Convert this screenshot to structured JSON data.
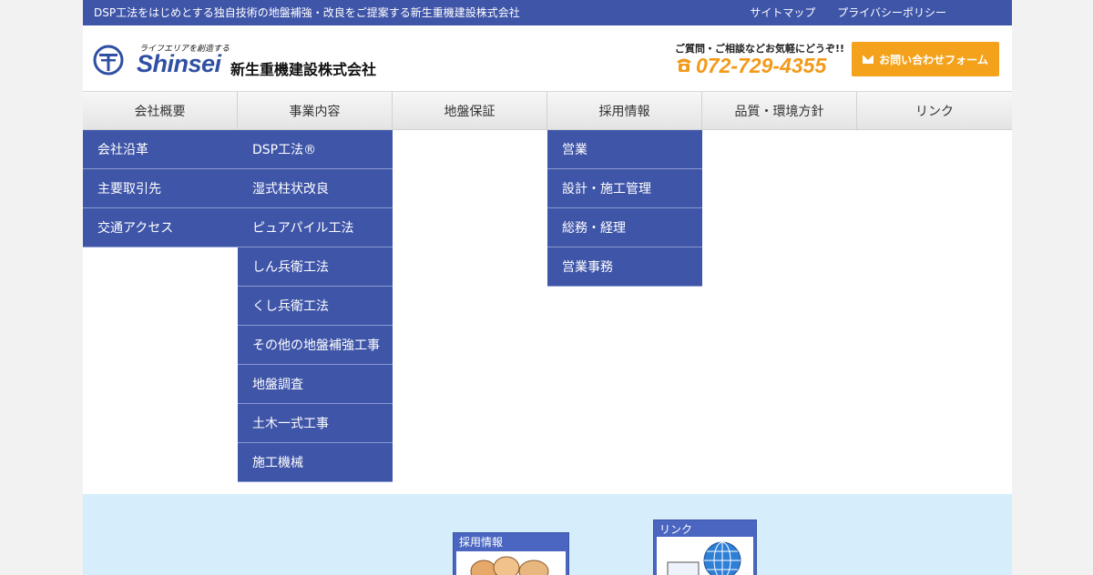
{
  "topbar": {
    "tagline": "DSP工法をはじめとする独自技術の地盤補強・改良をご提案する新生重機建設株式会社",
    "links": [
      "サイトマップ",
      "プライバシーポリシー"
    ]
  },
  "logo": {
    "slogan": "ライフエリアを創造する",
    "brand": "Shinsei",
    "company": "新生重機建設株式会社"
  },
  "contact": {
    "prompt": "ご質問・ご相談などお気軽にどうぞ!!",
    "phone": "072-729-4355",
    "form_button": "お問い合わせフォーム"
  },
  "nav": {
    "items": [
      "会社概要",
      "事業内容",
      "地盤保証",
      "採用情報",
      "品質・環境方針",
      "リンク"
    ]
  },
  "dropdowns": {
    "company": [
      "会社沿革",
      "主要取引先",
      "交通アクセス"
    ],
    "business": [
      "DSP工法®",
      "湿式柱状改良",
      "ピュアパイル工法",
      "しん兵衛工法",
      "くし兵衛工法",
      "その他の地盤補強工事",
      "地盤調査",
      "土木一式工事",
      "施工機械"
    ],
    "recruit": [
      "営業",
      "設計・施工管理",
      "総務・経理",
      "営業事務"
    ]
  },
  "banners": {
    "recruit_title": "採用情報",
    "links_title": "リンク"
  },
  "colors": {
    "primary": "#3f55a8",
    "accent": "#f4a21b",
    "banner_bg": "#d6eefb"
  }
}
